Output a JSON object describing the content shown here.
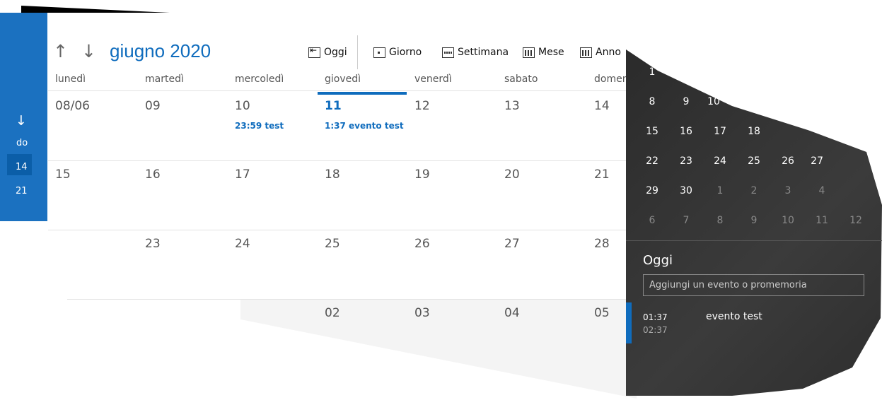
{
  "header": {
    "month_title": "giugno 2020",
    "today_label": "Oggi",
    "views": [
      "Giorno",
      "Settimana",
      "Mese",
      "Anno"
    ]
  },
  "left_pane": {
    "label": "do",
    "days": [
      "14",
      "21"
    ]
  },
  "weekdays": [
    "lunedì",
    "martedì",
    "mercoledì",
    "giovedì",
    "venerdì",
    "sabato",
    "domenica"
  ],
  "weeks": [
    [
      "08/06",
      "09",
      "10",
      "11",
      "12",
      "13",
      "14"
    ],
    [
      "15",
      "16",
      "17",
      "18",
      "19",
      "20",
      "21"
    ],
    [
      "",
      "23",
      "24",
      "25",
      "26",
      "27",
      "28"
    ],
    [
      "",
      "",
      "",
      "02",
      "03",
      "04",
      "05"
    ]
  ],
  "cell_events": {
    "wed": "23:59 test",
    "thu": "1:37 evento test"
  },
  "flyout": {
    "mini_calendar": [
      [
        "1"
      ],
      [
        "8",
        "9",
        "10"
      ],
      [
        "15",
        "16",
        "17",
        "18"
      ],
      [
        "22",
        "23",
        "24",
        "25",
        "26",
        "27"
      ],
      [
        "29",
        "30",
        "1",
        "2",
        "3",
        "4"
      ],
      [
        "6",
        "7",
        "8",
        "9",
        "10",
        "11",
        "12"
      ]
    ],
    "section_title": "Oggi",
    "add_placeholder": "Aggiungi un evento o promemoria",
    "agenda": {
      "start": "01:37",
      "end": "02:37",
      "title": "evento test"
    }
  },
  "colors": {
    "accent": "#0f6cbd",
    "left_pane": "#1b71c0",
    "flyout_bg": "#2b2b2b"
  }
}
